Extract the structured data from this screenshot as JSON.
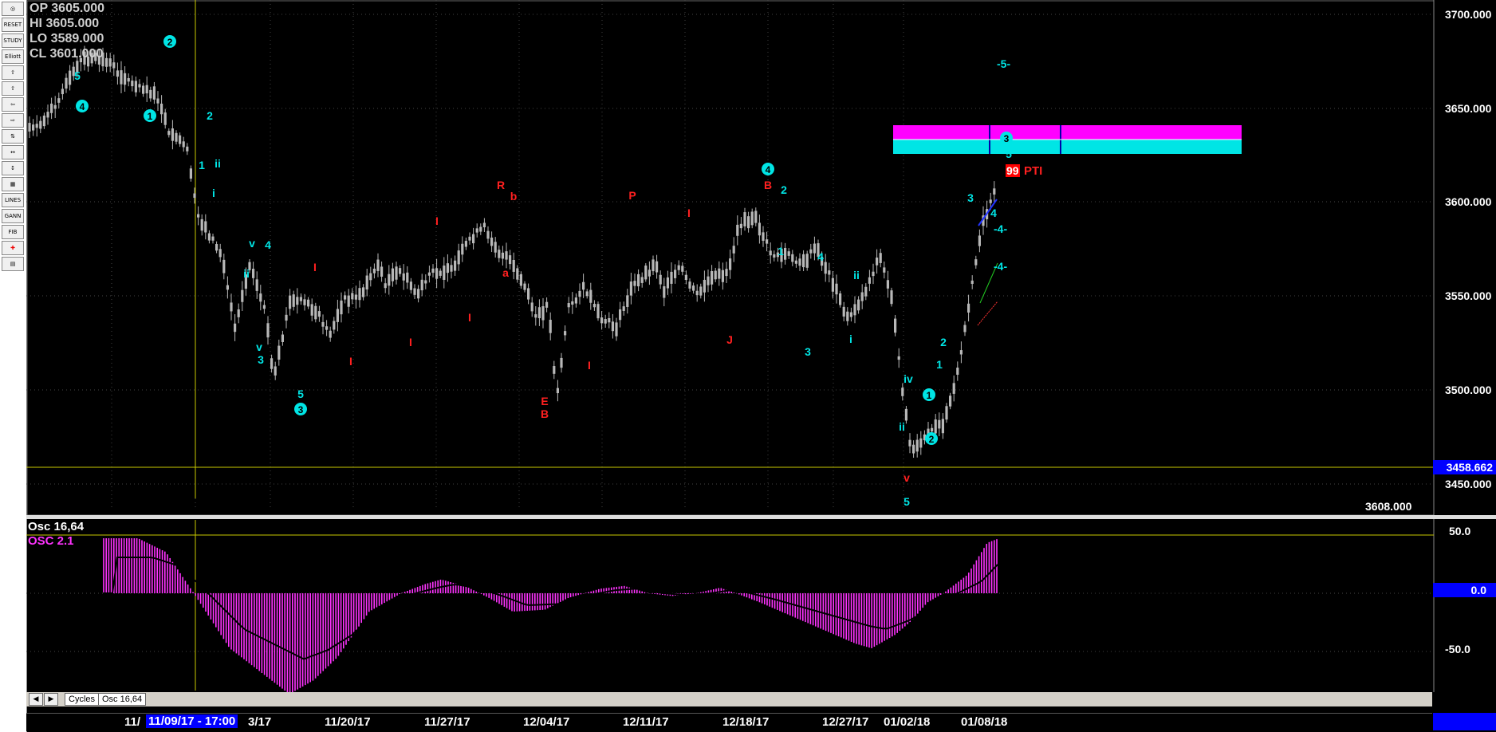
{
  "toolbar": {
    "items": [
      "zoom",
      "RESET",
      "STUDY",
      "Elliott",
      "up",
      "up2",
      "left",
      "right",
      "cycle",
      "expand",
      "compress",
      "grid",
      "LINES",
      "GANN",
      "FIB",
      "cross",
      "print"
    ]
  },
  "ohlc": {
    "op": "OP  3605.000",
    "hi": "HI   3605.000",
    "lo": "LO  3589.000",
    "cl": "CL  3601.000"
  },
  "price_axis": {
    "labels": [
      "3700.000",
      "3650.000",
      "3600.000",
      "3550.000",
      "3500.000",
      "3450.000"
    ],
    "current_price": "3458.662",
    "readout": "3608.000"
  },
  "osc_axis": {
    "labels": [
      "50.0",
      "0.0",
      "-50.0"
    ],
    "zero_tag": "0.0"
  },
  "oscillator": {
    "title": "Osc 16,64",
    "subtitle": "OSC 2.1"
  },
  "tabs": {
    "cycles": "Cycles",
    "osc": "Osc 16,64"
  },
  "dates": {
    "cursor": "11/09/17 - 17:00",
    "items": [
      "11/",
      "3/17",
      "11/20/17",
      "11/27/17",
      "12/04/17",
      "12/11/17",
      "12/18/17",
      "12/27/17",
      "01/02/18",
      "01/08/18"
    ]
  },
  "annotations": {
    "pti": "PTI",
    "pti_num": "99",
    "wave5_target": "-5-",
    "wave4_a": "-4-",
    "wave4_b": "-4-"
  },
  "colors": {
    "wave_cyan": "#00e5e5",
    "wave_red": "#ff2020",
    "magenta": "#ff00ff",
    "candle": "#b8b8b8",
    "cursor_line": "#c8c800",
    "axis_tag": "#0000ff"
  }
}
